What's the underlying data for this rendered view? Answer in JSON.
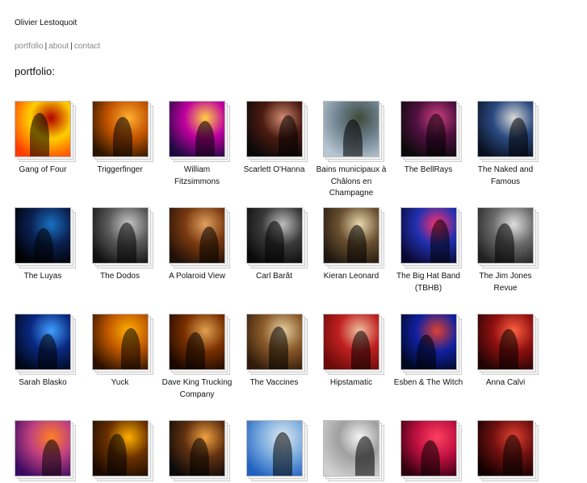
{
  "site": {
    "title": "Olivier Lestoquoit"
  },
  "nav": {
    "items": [
      "portfolio",
      "about",
      "contact"
    ],
    "separator": "|"
  },
  "page": {
    "title": "portfolio:"
  },
  "gallery": [
    {
      "caption": "Gang of Four",
      "colors": [
        "#ff3b00",
        "#ffcf00",
        "#b10000"
      ]
    },
    {
      "caption": "Triggerfinger",
      "colors": [
        "#2a1400",
        "#c45400",
        "#ffb030"
      ]
    },
    {
      "caption": "William Fitzsimmons",
      "colors": [
        "#1a0a40",
        "#c000a0",
        "#ffd040"
      ]
    },
    {
      "caption": "Scarlett O'Hanna",
      "colors": [
        "#080808",
        "#4a1a10",
        "#d08a70"
      ]
    },
    {
      "caption": "Bains municipaux à Châlons en Champagne",
      "colors": [
        "#b7c6d3",
        "#6d7f8c",
        "#3d4a3a"
      ]
    },
    {
      "caption": "The BellRays",
      "colors": [
        "#0a0a0a",
        "#501040",
        "#d04080"
      ]
    },
    {
      "caption": "The Naked and Famous",
      "colors": [
        "#0a1020",
        "#2a4a80",
        "#d8d8d8"
      ]
    },
    {
      "caption": "The Luyas",
      "colors": [
        "#000000",
        "#0a2050",
        "#1a70c0"
      ]
    },
    {
      "caption": "The Dodos",
      "colors": [
        "#101010",
        "#5a5a5a",
        "#c8c8c8"
      ]
    },
    {
      "caption": "A Polaroid View",
      "colors": [
        "#201008",
        "#7a3a10",
        "#e0a060"
      ]
    },
    {
      "caption": "Carl Barât",
      "colors": [
        "#0a0a0a",
        "#3a3a3a",
        "#bdbdbd"
      ]
    },
    {
      "caption": "Kieran Leonard",
      "colors": [
        "#201810",
        "#6a5030",
        "#e8d8b0"
      ]
    },
    {
      "caption": "The Big Hat Band (TBHB)",
      "colors": [
        "#0a0830",
        "#2030b0",
        "#ff3070"
      ]
    },
    {
      "caption": "The Jim Jones Revue",
      "colors": [
        "#202020",
        "#6a6a6a",
        "#dedede"
      ]
    },
    {
      "caption": "Sarah Blasko",
      "colors": [
        "#000818",
        "#0a2880",
        "#40a0ff"
      ]
    },
    {
      "caption": "Yuck",
      "colors": [
        "#2a1000",
        "#c05800",
        "#ffb000"
      ]
    },
    {
      "caption": "Dave King Trucking Company",
      "colors": [
        "#1a0800",
        "#7a3000",
        "#e0a050"
      ]
    },
    {
      "caption": "The Vaccines",
      "colors": [
        "#301a0a",
        "#8a5a2a",
        "#e8d0a0"
      ]
    },
    {
      "caption": "Hipstamatic",
      "colors": [
        "#6a0a0a",
        "#c02020",
        "#f0c0a0"
      ]
    },
    {
      "caption": "Esben & The Witch",
      "colors": [
        "#000820",
        "#1020a0",
        "#e04030"
      ]
    },
    {
      "caption": "Anna Calvi",
      "colors": [
        "#200404",
        "#901010",
        "#ff6040"
      ]
    },
    {
      "caption": "",
      "colors": [
        "#3a0a60",
        "#c04080",
        "#ff8020"
      ]
    },
    {
      "caption": "",
      "colors": [
        "#1a0a00",
        "#6a3000",
        "#ffb000"
      ]
    },
    {
      "caption": "",
      "colors": [
        "#0a0a0a",
        "#603010",
        "#f0a040"
      ]
    },
    {
      "caption": "",
      "colors": [
        "#2060c0",
        "#80b0e0",
        "#e0e8f0"
      ]
    },
    {
      "caption": "",
      "colors": [
        "#d0d0d0",
        "#a0a0a0",
        "#f4f4f4"
      ]
    },
    {
      "caption": "",
      "colors": [
        "#300010",
        "#c01040",
        "#ff4060"
      ]
    },
    {
      "caption": "",
      "colors": [
        "#100000",
        "#701010",
        "#e04030"
      ]
    }
  ]
}
